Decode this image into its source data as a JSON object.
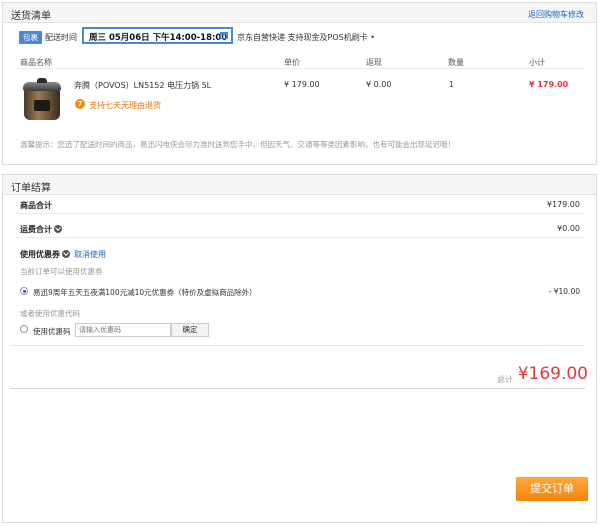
{
  "shipping": {
    "title": "送货清单",
    "back_link": "返回购物车修改",
    "badge": "包裹",
    "time_label": "配送时间",
    "time_value": "周三 05月06日 下午14:00-18:00",
    "delivery_info": "京东自营快递  支持现金及POS机刷卡 •",
    "columns": [
      "商品名称",
      "单价",
      "返现",
      "数量",
      "小计"
    ],
    "product": {
      "name": "奔腾（POVOS）LN5152 电压力锅 5L",
      "price": "¥ 179.00",
      "cashback": "¥ 0.00",
      "qty": "1",
      "subtotal": "¥ 179.00",
      "returns_icon": "7",
      "returns_text": "支持七天无理由退货"
    },
    "tip": "温馨提示：您选了配送时间的商品，易迅闪电侠会尽力准时送到您手中，但因天气、交通等等类因素影响，也有可能会出现延迟哦！"
  },
  "settlement": {
    "title": "订单结算",
    "goods_total_label": "商品合计",
    "goods_total_value": "¥179.00",
    "shipping_total_label": "运费合计",
    "shipping_total_value": "¥0.00",
    "coupon_label": "使用优惠券",
    "coupon_cancel": "取消使用",
    "coupon_note": "当前订单可以使用优惠券",
    "coupon_item": "易迅9周年五天五夜满100元减10元优惠券（特价及虚拟商品除外）",
    "coupon_amount": "- ¥10.00",
    "code_note": "或者使用优惠代码",
    "code_label": "使用优惠码",
    "code_placeholder": "请输入优惠码",
    "code_button": "确定",
    "total_label": "总计",
    "total_value": "¥169.00",
    "submit": "提交订单"
  },
  "colors": {
    "accent_blue": "#4a88d6",
    "price_red": "#e4393c",
    "submit_orange": "#f2860e"
  }
}
